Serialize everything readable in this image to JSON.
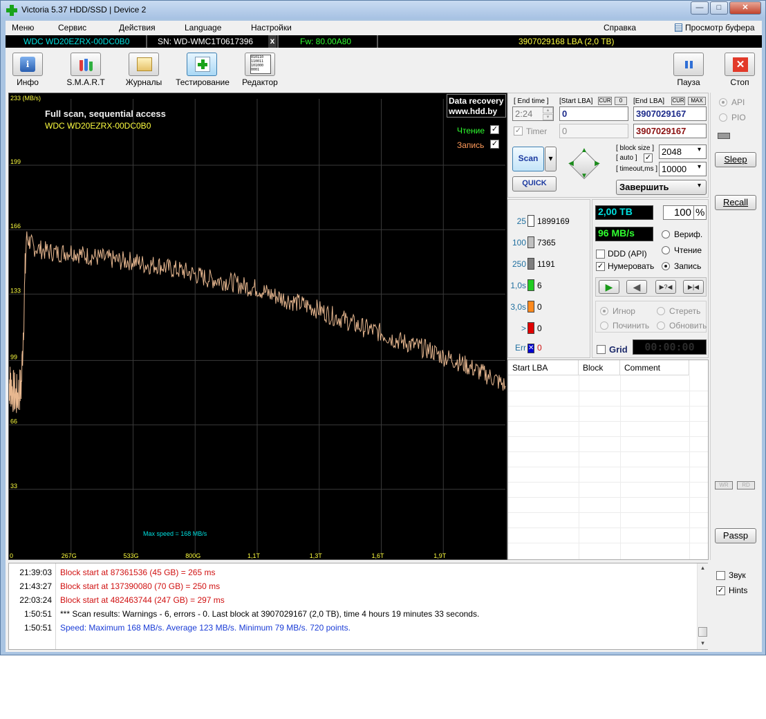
{
  "window": {
    "title": "Victoria 5.37 HDD/SSD | Device 2",
    "min_glyph": "—",
    "max_glyph": "□",
    "close_glyph": "✕"
  },
  "menu": {
    "items": [
      "Меню",
      "Сервис",
      "Действия",
      "Language",
      "Настройки"
    ],
    "help": "Справка",
    "buffer": "Просмотр буфера"
  },
  "device": {
    "model": "WDC WD20EZRX-00DC0B0",
    "serial": "SN: WD-WMC1T0617396",
    "close": "x",
    "firmware": "Fw: 80.00A80",
    "capacity": "3907029168 LBA (2,0 TB)"
  },
  "toolbar": {
    "info": "Инфо",
    "smart": "S.M.A.R.T",
    "logs": "Журналы",
    "testing": "Тестирование",
    "editor": "Редактор",
    "pause": "Пауза",
    "stop": "Стоп"
  },
  "graph": {
    "y_unit": "233 (MB/s)",
    "title": "Full scan, sequential access",
    "model": "WDC WD20EZRX-00DC0B0",
    "brand_line1": "Data recovery",
    "brand_line2": "www.hdd.by",
    "legend_read": "Чтение",
    "legend_write": "Запись",
    "max_speed_label": "Max speed = 168 MB/s"
  },
  "chart_data": {
    "type": "line",
    "y_ticks": [
      "199",
      "166",
      "133",
      "99",
      "66",
      "33"
    ],
    "x_ticks": [
      "0",
      "267G",
      "533G",
      "800G",
      "1,1T",
      "1,3T",
      "1,6T",
      "1,9T"
    ],
    "ylim": [
      0,
      233
    ],
    "xlim_tb": [
      0,
      2.0
    ],
    "grid": true,
    "series": [
      {
        "x_tb": [
          0.0,
          0.01,
          0.03,
          0.05,
          0.07,
          0.1,
          0.15,
          0.2,
          0.25,
          0.3,
          0.35,
          0.4,
          0.45,
          0.5,
          0.55,
          0.6,
          0.65,
          0.7,
          0.75,
          0.8,
          0.85,
          0.9,
          0.95,
          1.0,
          1.05,
          1.1,
          1.15,
          1.2,
          1.25,
          1.3,
          1.35,
          1.4,
          1.45,
          1.5,
          1.55,
          1.6,
          1.65,
          1.7,
          1.75,
          1.8,
          1.85,
          1.9,
          1.95,
          2.0
        ],
        "mb_s": [
          88,
          85,
          80,
          86,
          162,
          157,
          155,
          154,
          155,
          153,
          152,
          151,
          150,
          150,
          148,
          148,
          146,
          145,
          143,
          141,
          140,
          139,
          137,
          136,
          133,
          131,
          129,
          127,
          125,
          122,
          120,
          117,
          115,
          113,
          110,
          108,
          106,
          104,
          101,
          99,
          96,
          93,
          90,
          86
        ]
      }
    ]
  },
  "controls": {
    "end_time_label": "[ End time ]",
    "start_lba_label": "[Start LBA]",
    "cur_label": "CUR",
    "zero_label": "0",
    "end_lba_label": "[End LBA]",
    "max_label": "MAX",
    "end_time_value": "2:24",
    "start_lba_value": "0",
    "end_lba_value": "3907029167",
    "timer_label": "Timer",
    "timer_value": "0",
    "end_lba_value2": "3907029167",
    "scan_button": "Scan",
    "quick_button": "QUICK",
    "block_size_label": "[ block size ]",
    "auto_label": "[ auto ]",
    "block_size_value": "2048",
    "timeout_label": "[ timeout,ms ]",
    "timeout_value": "10000",
    "finish_select": "Завершить",
    "arrow_up": "▲",
    "arrow_down": "▼",
    "arrow_left": "◀",
    "arrow_right": "▶",
    "dropdown_glyph": "▾",
    "spin_up": "▴",
    "spin_down": "▾",
    "check_mark": "✓"
  },
  "stats": {
    "rows": [
      {
        "label": "25",
        "count": "1899169",
        "color": "#ffffff",
        "label_color": "#1f6f9f"
      },
      {
        "label": "100",
        "count": "7365",
        "color": "#c0c0c0",
        "label_color": "#1f6f9f"
      },
      {
        "label": "250",
        "count": "1191",
        "color": "#7e7e7e",
        "label_color": "#1f6f9f"
      },
      {
        "label": "1,0s",
        "count": "6",
        "color": "#22cc22",
        "label_color": "#1f6f9f"
      },
      {
        "label": "3,0s",
        "count": "0",
        "color": "#ff8a1e",
        "label_color": "#1f6f9f"
      },
      {
        "label": ">",
        "count": "0",
        "color": "#e00000",
        "label_color": "#1f6f9f"
      },
      {
        "label": "Err",
        "count": "0",
        "color": "#0000d0",
        "label_color": "#1f6f9f"
      }
    ],
    "err_glyph": "✕"
  },
  "status": {
    "size": "2,00 TB",
    "percent": "100",
    "percent_sign": "%",
    "speed": "96 MB/s",
    "verify": "Вериф.",
    "read": "Чтение",
    "write": "Запись",
    "ddd": "DDD (API)",
    "numbering": "Нумеровать",
    "ignore": "Игнор",
    "erase": "Стереть",
    "repair": "Починить",
    "refresh": "Обновить",
    "grid": "Grid",
    "grid_timer": "00:00:00",
    "play_glyph": "▶",
    "back_glyph": "◀",
    "unknown_glyph": "▶?◀",
    "end_glyph": "▶|◀"
  },
  "table": {
    "headers": [
      "Start LBA",
      "Block",
      "Comment"
    ]
  },
  "side": {
    "api": "API",
    "pio": "PIO",
    "sleep": "Sleep",
    "recall": "Recall",
    "wr": "WR",
    "rd": "RD",
    "passp": "Passp",
    "sound": "Звук",
    "hints": "Hints"
  },
  "log": {
    "entries": [
      {
        "time": "21:39:03",
        "msg": "Block start at 87361536 (45 GB)  = 265 ms",
        "color": "#d01010"
      },
      {
        "time": "21:43:27",
        "msg": "Block start at 137390080 (70 GB)  = 250 ms",
        "color": "#d01010"
      },
      {
        "time": "22:03:24",
        "msg": "Block start at 482463744 (247 GB)  = 297 ms",
        "color": "#d01010"
      },
      {
        "time": "1:50:51",
        "msg": "*** Scan results: Warnings - 6, errors - 0. Last block at 3907029167 (2,0 TB), time 4 hours 19 minutes 33 seconds.",
        "color": "#000000"
      },
      {
        "time": "1:50:51",
        "msg": "Speed: Maximum 168 MB/s. Average 123 MB/s. Minimum 79 MB/s. 720 points.",
        "color": "#1a3cd6"
      }
    ],
    "scroll_up": "▴",
    "scroll_down": "▾"
  },
  "colors": {
    "graph_line": "#e8b890",
    "graph_grid": "#3a3a3a",
    "cyan": "#00e0e0",
    "yellow": "#ffff40",
    "green": "#30ff30"
  }
}
